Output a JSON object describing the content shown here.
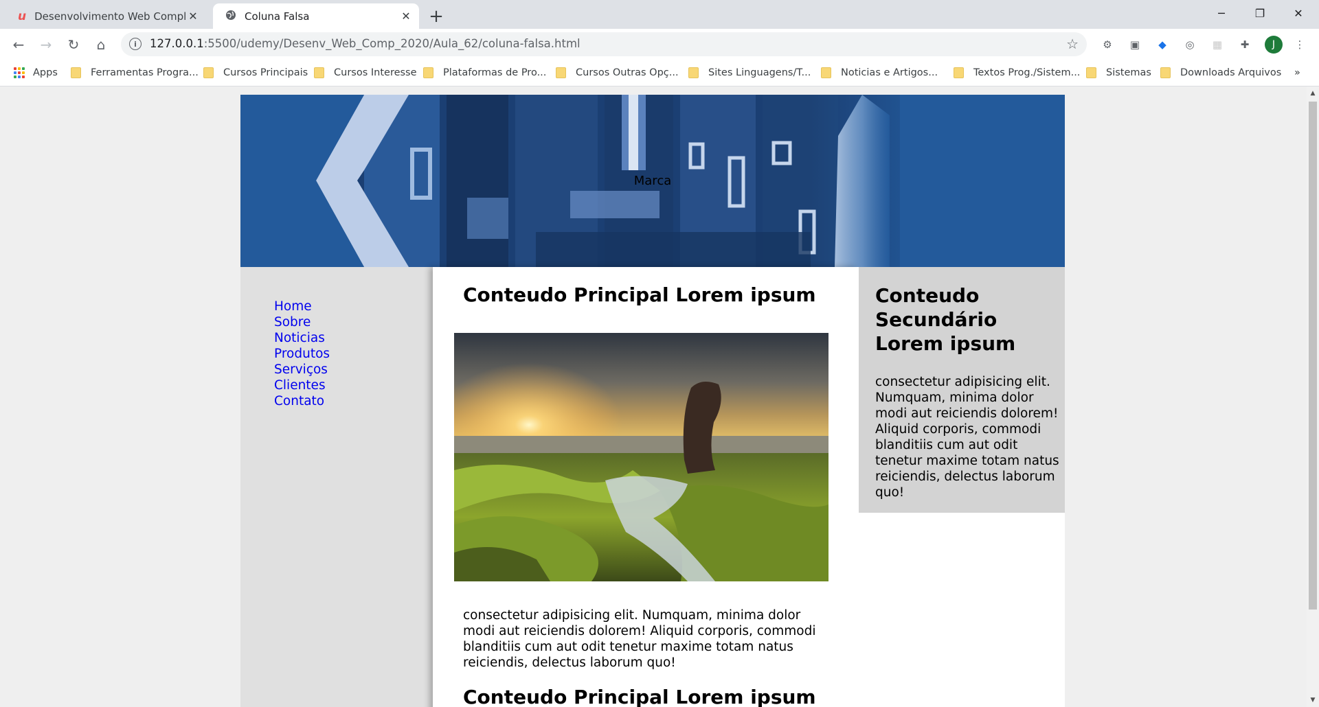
{
  "browser": {
    "tabs": [
      {
        "title": "Desenvolvimento Web Completo",
        "active": false,
        "icon": "udemy-icon"
      },
      {
        "title": "Coluna Falsa",
        "active": true,
        "icon": "globe-icon"
      }
    ],
    "address": {
      "host": "127.0.0.1",
      "path": ":5500/udemy/Desenv_Web_Comp_2020/Aula_62/coluna-falsa.html"
    },
    "profile_initial": "J",
    "bookmarks": [
      "Apps",
      "Ferramentas Progra...",
      "Cursos Principais",
      "Cursos Interesse",
      "Plataformas de Pro...",
      "Cursos Outras Opç...",
      "Sites Linguagens/T...",
      "Noticias e Artigos...",
      "Textos Prog./Sistem...",
      "Sistemas",
      "Downloads Arquivos"
    ],
    "bookmarks_overflow": "»"
  },
  "page": {
    "brand": "Marca",
    "menu": [
      "Home",
      "Sobre",
      "Noticias",
      "Produtos",
      "Serviços",
      "Clientes",
      "Contato"
    ],
    "main": {
      "heading": "Conteudo Principal Lorem ipsum",
      "text": "consectetur adipisicing elit. Numquam, minima dolor modi aut reiciendis dolorem! Aliquid corporis, commodi blanditiis cum aut odit tenetur maxime totam natus reiciendis, delectus laborum quo!",
      "heading2": "Conteudo Principal Lorem ipsum"
    },
    "aside": {
      "heading": "Conteudo Secundário Lorem ipsum",
      "text": "consectetur adipisicing elit. Numquam, minima dolor modi aut reiciendis dolorem! Aliquid corporis, commodi blanditiis cum aut odit tenetur maxime totam natus reiciendis, delectus laborum quo!"
    }
  },
  "colors": {
    "header_bg": "#235a9b",
    "sidebar_bg": "#e0e0e0",
    "aside_bg": "#d3d3d3",
    "link": "#0000ee"
  }
}
